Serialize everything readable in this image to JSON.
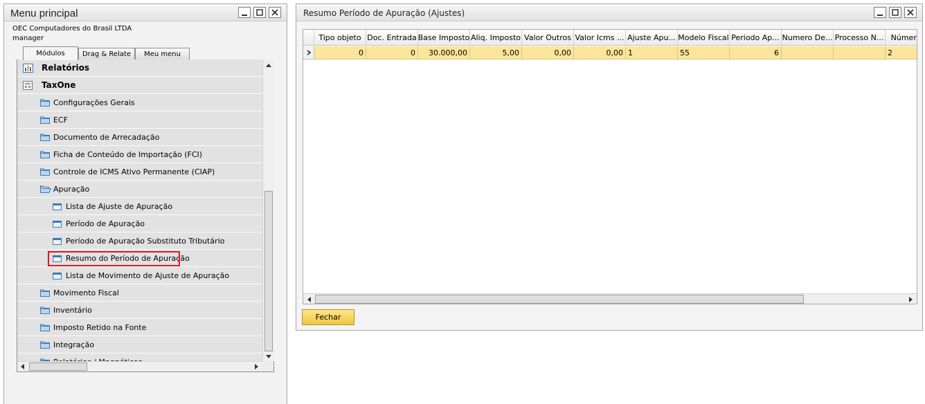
{
  "menu": {
    "title": "Menu principal",
    "company": "OEC Computadores do Brasil LTDA",
    "user": "manager",
    "tabs": [
      {
        "label": "Módulos",
        "active": true
      },
      {
        "label": "Drag & Relate",
        "active": false
      },
      {
        "label": "Meu menu",
        "active": false
      }
    ],
    "tree": [
      {
        "label": "Relatórios",
        "level": 0,
        "icon": "report-icon"
      },
      {
        "label": "TaxOne",
        "level": 0,
        "icon": "module-icon"
      },
      {
        "label": "Configurações Gerais",
        "level": 1,
        "icon": "folder-icon"
      },
      {
        "label": "ECF",
        "level": 1,
        "icon": "folder-icon"
      },
      {
        "label": "Documento de Arrecadação",
        "level": 1,
        "icon": "folder-icon"
      },
      {
        "label": "Ficha de Conteúdo de Importação (FCI)",
        "level": 1,
        "icon": "folder-icon"
      },
      {
        "label": "Controle de ICMS Ativo Permanente (CIAP)",
        "level": 1,
        "icon": "folder-icon"
      },
      {
        "label": "Apuração",
        "level": 1,
        "icon": "folder-open-icon"
      },
      {
        "label": "Lista de Ajuste de Apuração",
        "level": 2,
        "icon": "form-icon"
      },
      {
        "label": "Período de Apuração",
        "level": 2,
        "icon": "form-icon"
      },
      {
        "label": "Período de Apuração Substituto Tributário",
        "level": 2,
        "icon": "form-icon"
      },
      {
        "label": "Resumo do Período de Apuração",
        "level": 2,
        "icon": "form-icon",
        "highlighted": true
      },
      {
        "label": "Lista de Movimento de Ajuste de Apuração",
        "level": 2,
        "icon": "form-icon"
      },
      {
        "label": "Movimento Fiscal",
        "level": 1,
        "icon": "folder-icon"
      },
      {
        "label": "Inventário",
        "level": 1,
        "icon": "folder-icon"
      },
      {
        "label": "Imposto Retido na Fonte",
        "level": 1,
        "icon": "folder-icon"
      },
      {
        "label": "Integração",
        "level": 1,
        "icon": "folder-icon"
      },
      {
        "label": "Relatórios / Magnéticos",
        "level": 1,
        "icon": "folder-icon"
      }
    ]
  },
  "resumo": {
    "title": "Resumo Período de Apuração (Ajustes)",
    "columns": [
      "Tipo objeto",
      "Doc. Entrada",
      "Base Imposto",
      "Aliq. Imposto",
      "Valor Outros",
      "Valor Icms ...",
      "Ajuste Apu...",
      "Modelo Fiscal",
      "Periodo Ap...",
      "Numero De...",
      "Processo N...",
      "Número"
    ],
    "rows": [
      [
        "0",
        "0",
        "30.000,00",
        "5,00",
        "0,00",
        "0,00",
        "1",
        "55",
        "6",
        "",
        "",
        "2"
      ]
    ],
    "close_label": "Fechar"
  },
  "colors": {
    "selected_row": "#fbe59a",
    "highlight_border": "#e3161b",
    "button": "#f1c53e"
  }
}
